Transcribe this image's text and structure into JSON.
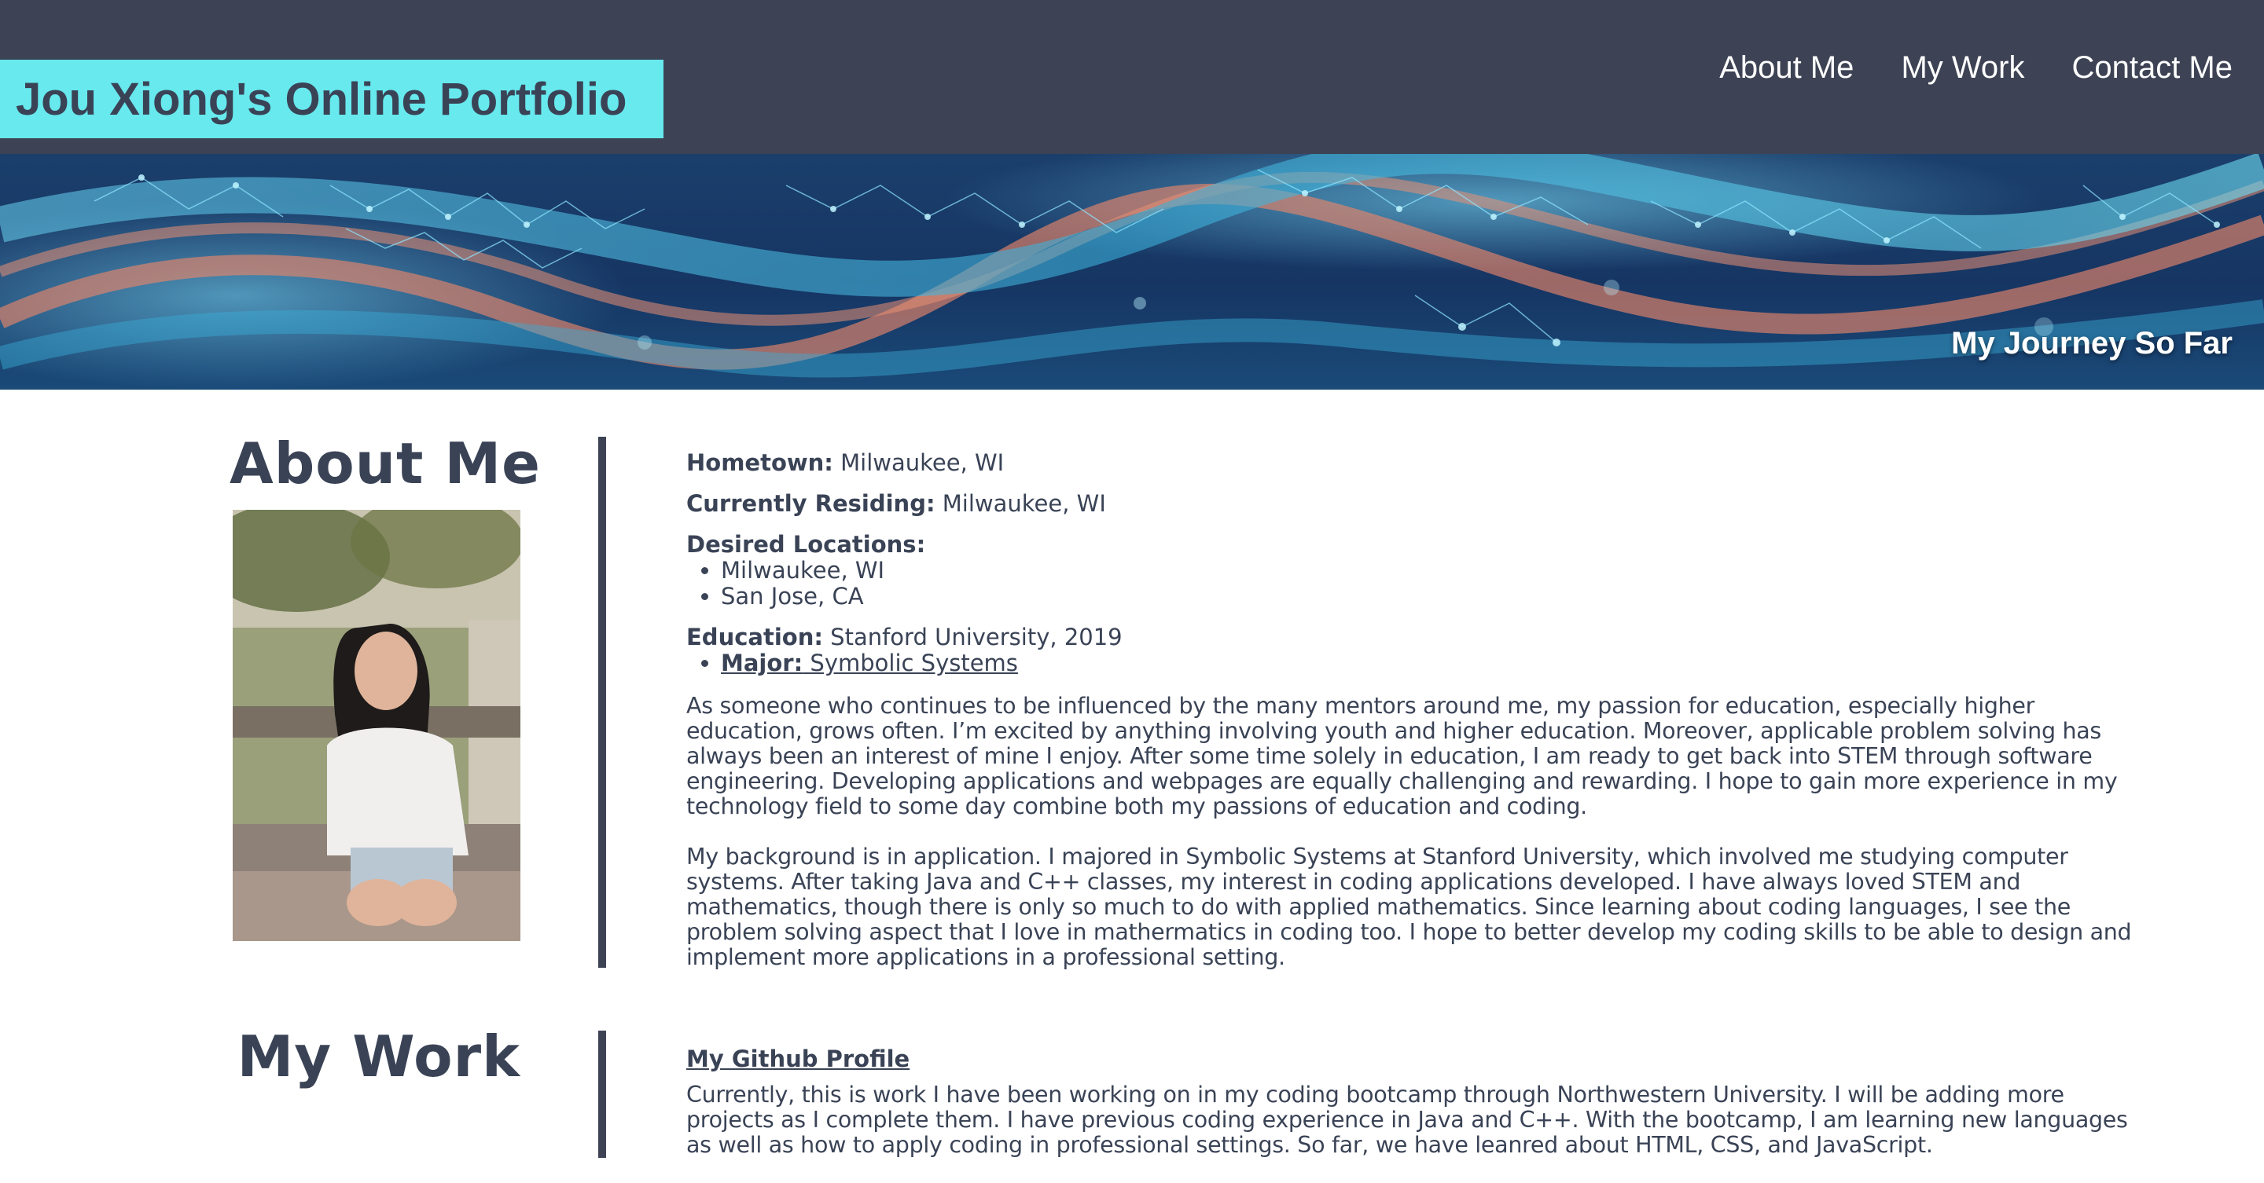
{
  "header": {
    "site_title": "Jou Xiong's Online Portfolio",
    "nav": [
      {
        "label": "About Me"
      },
      {
        "label": "My Work"
      },
      {
        "label": "Contact Me"
      }
    ]
  },
  "hero": {
    "tagline": "My Journey So Far"
  },
  "about": {
    "heading": "About Me",
    "hometown_label": "Hometown:",
    "hometown_value": "Milwaukee, WI",
    "residing_label": "Currently Residing:",
    "residing_value": "Milwaukee, WI",
    "desired_label": "Desired Locations:",
    "desired_locations": [
      "Milwaukee, WI",
      "San Jose, CA"
    ],
    "education_label": "Education:",
    "education_value": "Stanford University, 2019",
    "major_label": "Major:",
    "major_value": "Symbolic Systems",
    "paragraphs": [
      "As someone who continues to be influenced by the many mentors around me, my passion for education, especially higher education, grows often. I’m excited by anything involving youth and higher education. Moreover, applicable problem solving has always been an interest of mine I enjoy. After some time solely in education, I am ready to get back into STEM through software engineering. Developing applications and webpages are equally challenging and rewarding. I hope to gain more experience in my technology field to some day combine both my passions of education and coding.",
      "My background is in application. I majored in Symbolic Systems at Stanford University, which involved me studying computer systems. After taking Java and C++ classes, my interest in coding applications developed. I have always loved STEM and mathematics, though there is only so much to do with applied mathematics. Since learning about coding languages, I see the problem solving aspect that I love in mathermatics in coding too. I hope to better develop my coding skills to be able to design and implement more applications in a professional setting."
    ]
  },
  "work": {
    "heading": "My Work",
    "github_link": "My Github Profile",
    "paragraph": "Currently, this is work I have been working on in my coding bootcamp through Northwestern University. I will be adding more projects as I complete them. I have previous coding experience in Java and C++. With the bootcamp, I am learning new languages as well as how to apply coding in professional settings. So far, we have leanred about HTML, CSS, and JavaScript."
  },
  "colors": {
    "header_bg": "#3d4354",
    "title_bg": "#67e9ee",
    "text": "#3a4356"
  }
}
